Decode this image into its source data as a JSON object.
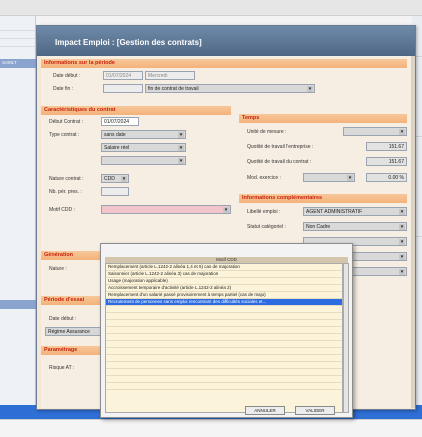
{
  "window": {
    "title": "Impact Emploi : [Gestion des contrats]"
  },
  "background": {
    "left_tag": "SAMLT"
  },
  "periode": {
    "section": "Informations sur la période",
    "date_debut_label": "Date début :",
    "date_debut_value": "01/07/2024",
    "date_debut_text": "Mercredi",
    "date_fin_label": "Date fin :",
    "date_fin_value": "",
    "date_fin_type": "fin de contrat de travail"
  },
  "contrat": {
    "section": "Caractéristiques du contrat",
    "debut_label": "Début Contrat :",
    "debut_value": "01/07/2024",
    "type_label": "Type contrat :",
    "type_value": "sans date",
    "type_value2": "Salaire réel",
    "nature_label": "Nature contrat :",
    "nature_value": "CDD",
    "nb_period_label": "Nb. pér. pres. :",
    "motif_label": "Motif CDD :",
    "motif_value": ""
  },
  "temps": {
    "section": "Temps",
    "unite_label": "Unité de mesure :",
    "qt_travail_entreprise_label": "Quotité de travail l'entreprise :",
    "qt_travail_entreprise_value": "151.67",
    "qt_travail_contrat_label": "Quotité de travail du contrat :",
    "qt_travail_contrat_value": "151.67",
    "modalite_label": "Mod. exercice :",
    "modalite_value": "0.00 %"
  },
  "complementaires": {
    "section": "Informations complémentaires",
    "libelle_label": "Libellé emploi :",
    "libelle_value": "AGENT ADMINISTRATIF",
    "statut_label": "Statut catégoriel :",
    "statut_value": "Non Cadre"
  },
  "left_sections": {
    "generation": "Génération",
    "nature_label": "Nature :",
    "periode_essai": "Période d'essai",
    "date_debut": "Date début :",
    "regime": "Régime Assurance",
    "parametrage": "Paramétrage",
    "risque": "Risque AT :"
  },
  "popup": {
    "header": "Motif CDD",
    "rows": [
      "Remplacement (article L.1242-2 alinéa 1,4 et 5) cas de majoration",
      "Saisonnier (article L.1242-2 alinéa 3) cas de majoration",
      "Usage (majoration applicable)",
      "Accroissement temporaire d'activité (article L.1242-2 alinéa 2)",
      "Remplacement d'un salarié passé provisoirement à temps partiel (cas de majo)",
      "Recrutement de personnes sans emploi rencontrant des difficultés sociales et..."
    ],
    "selected_index": 5,
    "empty_rows": 12,
    "btn_cancel": "ANNULER",
    "btn_validate": "VALIDER"
  }
}
